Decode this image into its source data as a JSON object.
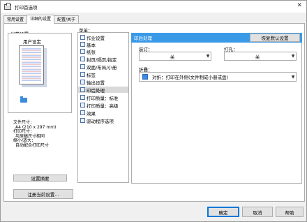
{
  "window": {
    "title": "打印首选项"
  },
  "tabs": [
    {
      "label": "常用设置"
    },
    {
      "label": "详细的设置"
    },
    {
      "label": "配置/关于"
    }
  ],
  "left": {
    "current_setting_label": "当前设置",
    "user_setting_label": "用户设定",
    "info_lines": [
      "文件尺寸：",
      "A4 (210 x 297 mm)",
      "打印尺寸：",
      "与原稿尺寸相同",
      "缩小/放大：",
      "自动配合打印尺寸"
    ],
    "settings_summary_button": "设置摘要",
    "register_button": "注册当前设置..."
  },
  "menu": {
    "label": "菜单：",
    "items": [
      {
        "label": "作业设置"
      },
      {
        "label": "基本"
      },
      {
        "label": "纸张"
      },
      {
        "label": "封页/隔页/指定"
      },
      {
        "label": "双面/布局/小册"
      },
      {
        "label": "标签"
      },
      {
        "label": "输出设置"
      },
      {
        "label": "印后处理"
      },
      {
        "label": "打印质量：标准"
      },
      {
        "label": "打印质量：高级"
      },
      {
        "label": "效果"
      },
      {
        "label": "驱动程序选项"
      }
    ],
    "selected_index": 7
  },
  "panel": {
    "title": "印后处理",
    "restore_button": "恢复默认设置",
    "staple": {
      "label": "装订：",
      "value": "关"
    },
    "punch": {
      "label": "打孔：",
      "value": "关"
    },
    "fold": {
      "label": "折叠：",
      "value": "对折：打印在外侧(文件制成小册或盘)"
    }
  },
  "footer": {
    "ok": "确定",
    "cancel": "取消",
    "help": "帮助"
  },
  "colors": {
    "panel_header": "#3b9ae8",
    "selected_menu": "#d9d9d9",
    "accent": "#0078d7"
  }
}
